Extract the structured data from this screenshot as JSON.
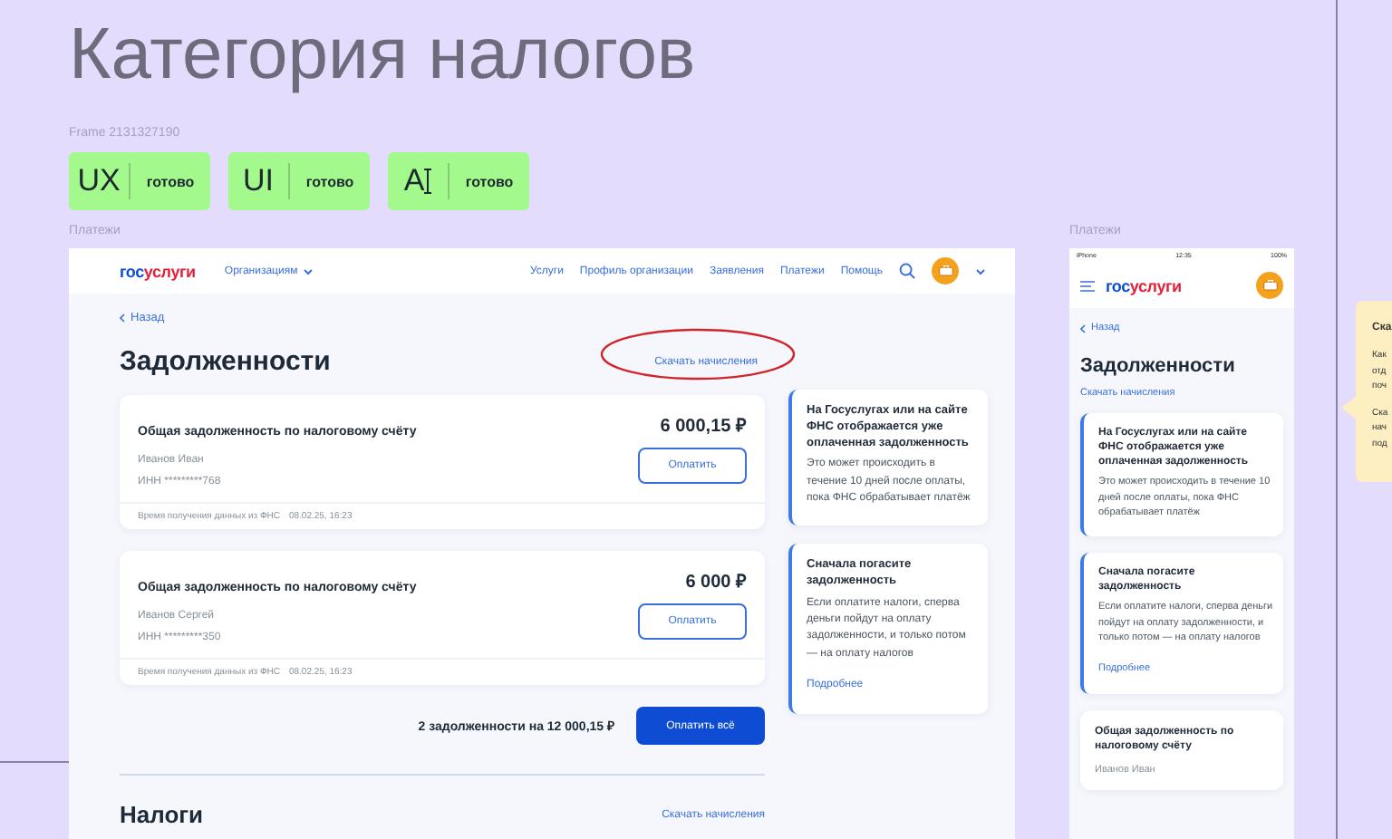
{
  "canvas": {
    "title": "Категория налогов",
    "frame_label": "Frame 2131327190",
    "badges": [
      {
        "kind": "text",
        "symbol": "UX",
        "status": "готово"
      },
      {
        "kind": "text",
        "symbol": "UI",
        "status": "готово"
      },
      {
        "kind": "cursor",
        "symbol": "A",
        "status": "готово"
      }
    ]
  },
  "desktop": {
    "label": "Платежи",
    "logo": {
      "part1": "гос",
      "part2": "услуги"
    },
    "menu": "Организациям",
    "nav": [
      "Услуги",
      "Профиль организации",
      "Заявления",
      "Платежи",
      "Помощь"
    ],
    "back": "Назад",
    "title": "Задолженности",
    "download": "Скачать начисления",
    "debts": [
      {
        "title": "Общая задолженность по налоговому счёту",
        "name": "Иванов Иван",
        "inn": "ИНН *********768",
        "amount": "6 000,15 ₽",
        "button": "Оплатить",
        "time_label": "Время получения данных из ФНС",
        "time": "08.02.25, 16:23"
      },
      {
        "title": "Общая задолженность по налоговому счёту",
        "name": "Иванов Сергей",
        "inn": "ИНН *********350",
        "amount": "6 000 ₽",
        "button": "Оплатить",
        "time_label": "Время получения данных из ФНС",
        "time": "08.02.25, 16:23"
      }
    ],
    "total": "2 задолженности на 12 000,15 ₽",
    "pay_all": "Оплатить всё",
    "info": [
      {
        "title": "На Госуслугах или на сайте ФНС отображается уже оплаченная задолженность",
        "text": "Это может происходить в течение 10 дней после оплаты, пока ФНС обрабатывает платёж"
      },
      {
        "title": "Сначала погасите задолженность",
        "text": "Если оплатите налоги, сперва деньги пойдут на оплату задолженности, и только потом — на оплату налогов",
        "link": "Подробнее"
      }
    ],
    "section2": {
      "title": "Налоги",
      "download": "Скачать начисления"
    }
  },
  "mobile": {
    "label": "Платежи",
    "status": {
      "carrier": "iPhone",
      "time": "12:35",
      "battery": "100%"
    },
    "logo": {
      "part1": "гос",
      "part2": "услуги"
    },
    "back": "Назад",
    "title": "Задолженности",
    "download": "Скачать начисления",
    "info": [
      {
        "title": "На Госуслугах или на сайте ФНС отображается уже оплаченная задолженность",
        "text": "Это может происходить в течение 10 дней после оплаты, пока ФНС обрабатывает платёж"
      },
      {
        "title": "Сначала погасите задолженность",
        "text": "Если оплатите налоги, сперва деньги пойдут на оплату задолженности, и только потом — на оплату налогов",
        "link": "Подробнее"
      }
    ],
    "debt": {
      "title": "Общая задолженность по налоговому счёту",
      "name": "Иванов Иван"
    }
  },
  "note": {
    "title": "Ска",
    "lines": [
      "Как",
      "отд",
      "поч",
      "Ска",
      "нач",
      "под"
    ]
  }
}
